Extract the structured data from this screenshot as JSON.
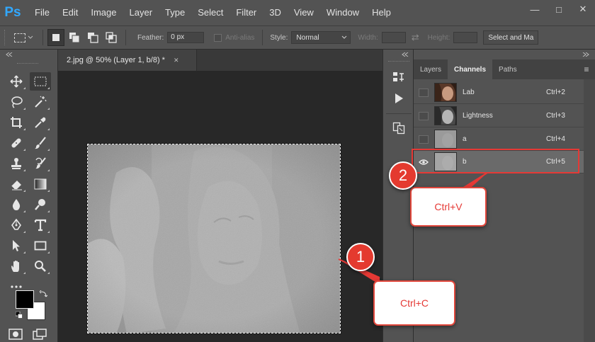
{
  "app": {
    "logo": "Ps"
  },
  "menu": {
    "items": [
      "File",
      "Edit",
      "Image",
      "Layer",
      "Type",
      "Select",
      "Filter",
      "3D",
      "View",
      "Window",
      "Help"
    ]
  },
  "window_controls": {
    "minimize": "—",
    "restore": "□",
    "close": "✕"
  },
  "options": {
    "feather_label": "Feather:",
    "feather_value": "0 px",
    "antialias_label": "Anti-alias",
    "style_label": "Style:",
    "style_value": "Normal",
    "width_label": "Width:",
    "height_label": "Height:",
    "select_mask_label": "Select and Ma"
  },
  "document": {
    "tab_title": "2.jpg @ 50% (Layer 1, b/8) *",
    "tab_close": "✕"
  },
  "panel": {
    "tabs": [
      "Layers",
      "Channels",
      "Paths"
    ],
    "active_tab": "Channels",
    "channels": [
      {
        "name": "Lab",
        "shortcut": "Ctrl+2",
        "visible": false,
        "selected": false
      },
      {
        "name": "Lightness",
        "shortcut": "Ctrl+3",
        "visible": false,
        "selected": false
      },
      {
        "name": "a",
        "shortcut": "Ctrl+4",
        "visible": false,
        "selected": false
      },
      {
        "name": "b",
        "shortcut": "Ctrl+5",
        "visible": true,
        "selected": true
      }
    ]
  },
  "annotations": {
    "step1": {
      "number": "1",
      "label": "Ctrl+C"
    },
    "step2": {
      "number": "2",
      "label": "Ctrl+V"
    }
  },
  "colors": {
    "accent_red": "#e53935",
    "ps_blue": "#31a8ff",
    "panel_bg": "#535353"
  }
}
